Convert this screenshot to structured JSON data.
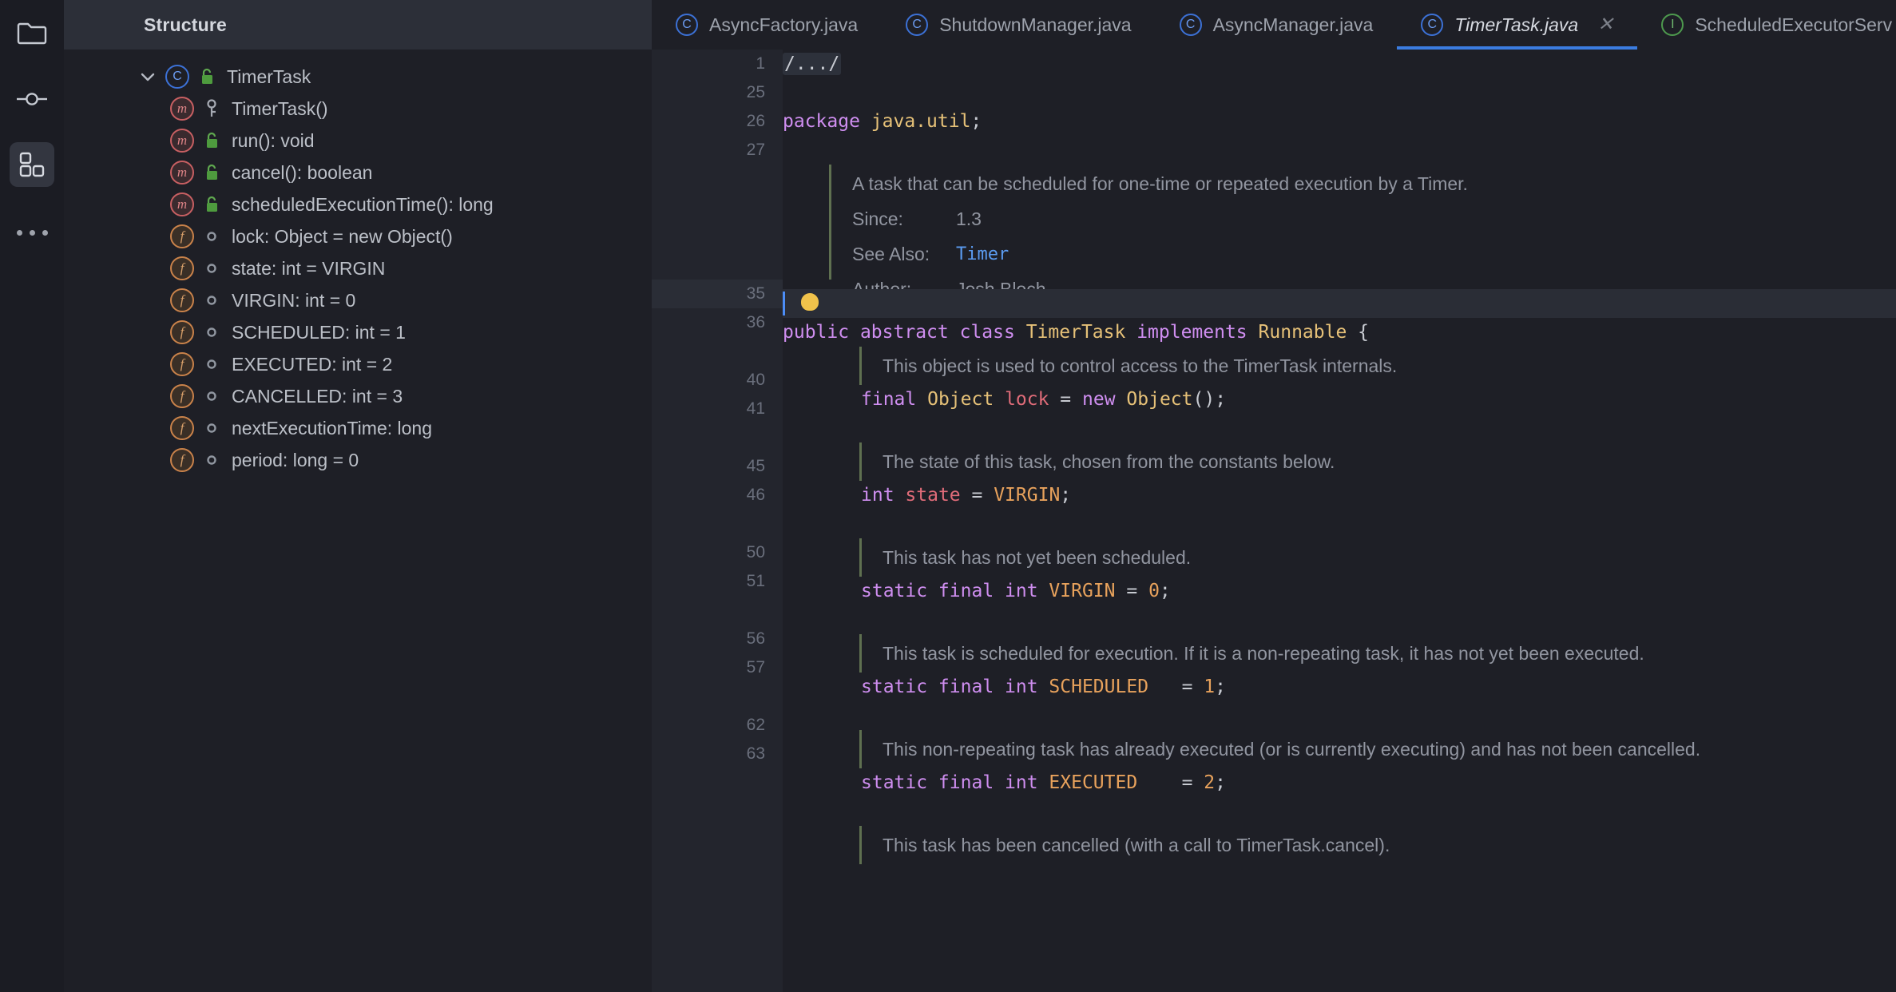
{
  "rail": {
    "items": [
      {
        "name": "project-folder",
        "icon": "folder-icon",
        "active": false
      },
      {
        "name": "commit",
        "icon": "commit-node-icon",
        "active": false
      },
      {
        "name": "structure",
        "icon": "structure-blocks-icon",
        "active": true
      },
      {
        "name": "more",
        "icon": "more-dots-icon",
        "active": false
      }
    ]
  },
  "structure": {
    "title": "Structure",
    "items": [
      {
        "label": "TimerTask",
        "kind": "C",
        "vis": "lock-open",
        "indent": 0,
        "expanded": true
      },
      {
        "label": "TimerTask()",
        "kind": "m",
        "vis": "key",
        "indent": 1
      },
      {
        "label": "run(): void",
        "kind": "m",
        "vis": "lock-open",
        "indent": 1
      },
      {
        "label": "cancel(): boolean",
        "kind": "m",
        "vis": "lock-open",
        "indent": 1
      },
      {
        "label": "scheduledExecutionTime(): long",
        "kind": "m",
        "vis": "lock-open",
        "indent": 1
      },
      {
        "label": "lock: Object = new Object()",
        "kind": "f",
        "vis": "dot",
        "indent": 1
      },
      {
        "label": "state: int = VIRGIN",
        "kind": "f",
        "vis": "dot",
        "indent": 1
      },
      {
        "label": "VIRGIN: int = 0",
        "kind": "f",
        "vis": "dot",
        "indent": 1
      },
      {
        "label": "SCHEDULED: int = 1",
        "kind": "f",
        "vis": "dot",
        "indent": 1
      },
      {
        "label": "EXECUTED: int = 2",
        "kind": "f",
        "vis": "dot",
        "indent": 1
      },
      {
        "label": "CANCELLED: int = 3",
        "kind": "f",
        "vis": "dot",
        "indent": 1
      },
      {
        "label": "nextExecutionTime: long",
        "kind": "f",
        "vis": "dot",
        "indent": 1
      },
      {
        "label": "period: long = 0",
        "kind": "f",
        "vis": "dot",
        "indent": 1
      }
    ]
  },
  "tabs": [
    {
      "label": "AsyncFactory.java",
      "icon": "java-class-icon",
      "active": false,
      "closable": false
    },
    {
      "label": "ShutdownManager.java",
      "icon": "java-class-icon",
      "active": false,
      "closable": false
    },
    {
      "label": "AsyncManager.java",
      "icon": "java-class-icon",
      "active": false,
      "closable": false
    },
    {
      "label": "TimerTask.java",
      "icon": "java-class-icon",
      "active": true,
      "closable": true
    },
    {
      "label": "ScheduledExecutorServ",
      "icon": "java-interface-icon",
      "active": false,
      "closable": false
    }
  ],
  "editor": {
    "file": "TimerTask.java",
    "gutter": [
      "1",
      "25",
      "26",
      "27",
      "",
      "",
      "",
      "",
      "35",
      "36",
      "",
      "40",
      "41",
      "",
      "45",
      "46",
      "",
      "50",
      "51",
      "",
      "56",
      "57",
      "",
      "62",
      "63",
      ""
    ],
    "fold_placeholder": "/.../",
    "lines": {
      "package": {
        "kw": "package",
        "name": "java.util",
        "end": ";"
      },
      "class_decl": {
        "kw1": "public",
        "kw2": "abstract",
        "kw3": "class",
        "name": "TimerTask",
        "kw4": "implements",
        "iface": "Runnable",
        "brace": "{"
      },
      "lock_field": "final Object lock = new Object();",
      "state_field": "int state = VIRGIN;",
      "virgin": "static final int VIRGIN = 0;",
      "scheduled": "static final int SCHEDULED   = 1;",
      "executed": "static final int EXECUTED    = 2;"
    },
    "javadoc": {
      "class_summary": "A task that can be scheduled for one-time or repeated execution by a Timer.",
      "since_label": "Since:",
      "since_value": "1.3",
      "seealso_label": "See Also:",
      "seealso_value": "Timer",
      "author_label": "Author:",
      "author_value": "Josh Bloch",
      "lock_doc": "This object is used to control access to the TimerTask internals.",
      "state_doc": "The state of this task, chosen from the constants below.",
      "virgin_doc": "This task has not yet been scheduled.",
      "scheduled_doc": "This task is scheduled for execution. If it is a non-repeating task, it has not yet been executed.",
      "executed_doc": "This non-repeating task has already executed (or is currently executing) and has not been cancelled.",
      "cancelled_doc": "This task has been cancelled (with a call to TimerTask.cancel)."
    }
  },
  "colors": {
    "background": "#1E1F26",
    "gutter": "#23252D",
    "header": "#2C2F38",
    "accent": "#3B7CE0",
    "keyword": "#CF8EF0",
    "type": "#E6C178",
    "field": "#E06C79",
    "constant": "#E8A25C",
    "comment": "#9195A0",
    "link": "#5B9BF0",
    "doc_border": "#5F7050",
    "caret": "#4C8DF6",
    "bulb": "#F0C24B"
  }
}
